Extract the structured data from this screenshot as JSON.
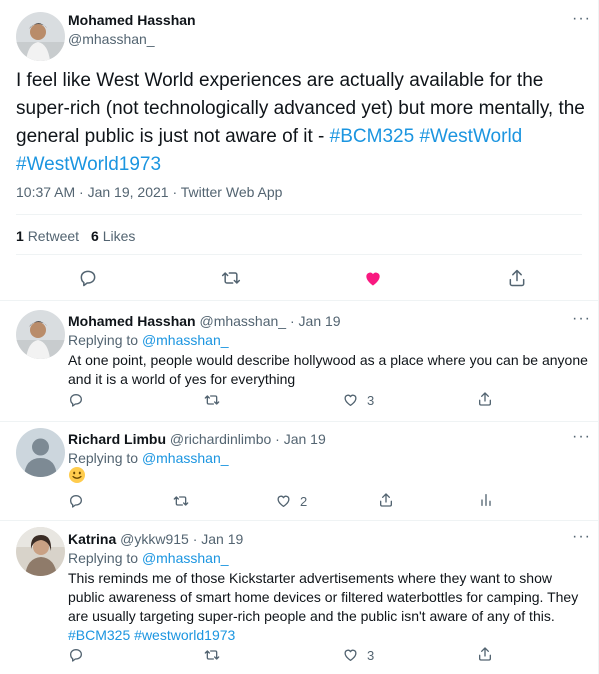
{
  "main": {
    "author_name": "Mohamed Hasshan",
    "author_handle": "@mhasshan_",
    "text_prefix": "I feel like West World experiences are actually available for the super-rich (not technologically advanced yet) but more mentally, the general public is just not aware of it - ",
    "hashtag1": "#BCM325",
    "hashtag2": "#WestWorld",
    "hashtag3": "#WestWorld1973",
    "timestamp": "10:37 AM · Jan 19, 2021 · Twitter Web App",
    "retweet_count": "1",
    "retweet_label": "Retweet",
    "like_count": "6",
    "like_label": "Likes"
  },
  "replies": [
    {
      "name": "Mohamed Hasshan",
      "handle": "@mhasshan_",
      "dot": "·",
      "time": "Jan 19",
      "replying_prefix": "Replying to",
      "replying_to": "@mhasshan_",
      "text": "At one point, people would describe hollywood as a place where you can be anyone and it is a world of yes for everything",
      "like_count": "3"
    },
    {
      "name": "Richard Limbu",
      "handle": "@richardinlimbo",
      "dot": "·",
      "time": "Jan 19",
      "replying_prefix": "Replying to",
      "replying_to": "@mhasshan_",
      "like_count": "2"
    },
    {
      "name": "Katrina",
      "handle": "@ykkw915",
      "dot": "·",
      "time": "Jan 19",
      "replying_prefix": "Replying to",
      "replying_to": "@mhasshan_",
      "text": "This reminds me of those Kickstarter advertisements where they want to show public awareness of smart home devices or filtered waterbottles for camping. They are usually targeting super-rich people and the public isn't aware of any of this. ",
      "hashtag1": "#BCM325",
      "hashtag2": "#westworld1973",
      "like_count": "3"
    }
  ],
  "more_glyph": "···",
  "colors": {
    "link": "#1b95e0",
    "muted": "#536471",
    "like_active": "#f91880",
    "divider": "#eff3f4"
  },
  "icons": [
    "reply-icon",
    "retweet-icon",
    "like-icon",
    "share-icon",
    "analytics-icon",
    "more-icon",
    "slightly-smiling-face-emoji"
  ]
}
